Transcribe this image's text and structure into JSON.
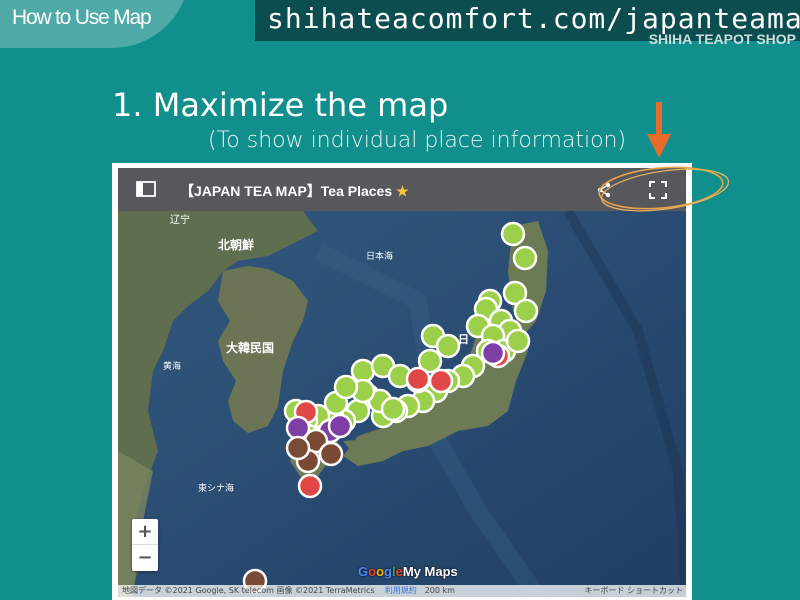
{
  "corner": {
    "label": "How to Use Map"
  },
  "header": {
    "url": "shihateacomfort.com/japanteamap",
    "shop": "SHIHA TEAPOT SHOP"
  },
  "step": {
    "title": "1. Maximize the map",
    "subtitle": "(To show individual place  information)"
  },
  "map": {
    "title": "【JAPAN TEA MAP】Tea Places",
    "icons": {
      "panel": "side-panel-icon",
      "star": "star-icon",
      "share": "share-icon",
      "fullscreen": "fullscreen-icon"
    },
    "labels": {
      "liaoning": "辽宁",
      "north_korea": "北朝鮮",
      "south_korea": "大韓民国",
      "sea_of_japan": "日本海",
      "yellow_sea": "黄海",
      "east_china_sea": "東シナ海",
      "japan": "日"
    },
    "zoom": {
      "in": "+",
      "out": "−"
    },
    "logo": {
      "g": "G",
      "o1": "o",
      "o2": "o",
      "g2": "g",
      "l": "l",
      "e": "e",
      "mymaps": "My Maps"
    },
    "attribution": {
      "data": "地図データ ©2021 Google, SK telecom 画像 ©2021 TerraMetrics",
      "terms": "利用規約",
      "scale": "200 km",
      "shortcuts": "キーボード ショートカット"
    }
  },
  "colors": {
    "background": "#108f8c",
    "url_bar": "#0c4e50",
    "arrow": "#ea6a2c",
    "marker_green": "#9ccf4a",
    "marker_red": "#e04848",
    "marker_purple": "#7d3fa6",
    "marker_brown": "#7a4b34"
  }
}
